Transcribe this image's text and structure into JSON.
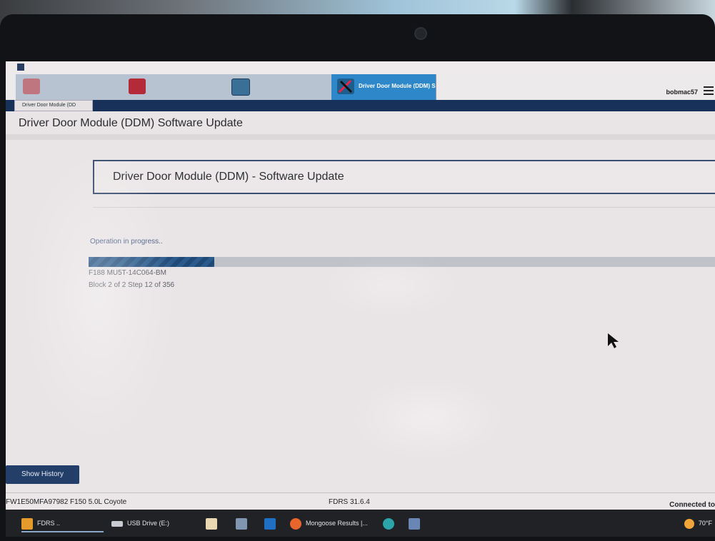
{
  "user": {
    "name": "bobmac57"
  },
  "tabs": [
    {
      "label": "",
      "icon": "vehicle-icon",
      "active": false
    },
    {
      "label": "",
      "icon": "toolbox-icon",
      "active": false
    },
    {
      "label": "",
      "icon": "grid-icon",
      "active": false
    },
    {
      "label": "Driver Door Module (DDM) S",
      "icon": "tools-icon",
      "active": true
    }
  ],
  "subtab": {
    "label": "Driver Door Module (DD"
  },
  "page": {
    "title": "Driver Door Module (DDM) Software Update",
    "panel_title": "Driver Door Module (DDM) - Software Update"
  },
  "progress": {
    "status_text": "Operation in progress..",
    "fraction": 0.2,
    "part_number": "F188 MU5T-14C064-BM",
    "step_text": "Block 2 of 2 Step 12 of 356"
  },
  "buttons": {
    "show_history": "Show History"
  },
  "status_bar": {
    "vin_vehicle": "FW1E50MFA97982  F150 5.0L Coyote",
    "version": "FDRS 31.6.4",
    "connection": "Connected to"
  },
  "taskbar": {
    "items": [
      {
        "label": "FDRS ..",
        "icon": "fdrs-app-icon"
      },
      {
        "label": "USB Drive (E:)",
        "icon": "usb-drive-icon"
      },
      {
        "label": "",
        "icon": "store-icon"
      },
      {
        "label": "",
        "icon": "app-icon"
      },
      {
        "label": "",
        "icon": "outlook-icon"
      },
      {
        "label": "Mongoose Results |...",
        "icon": "firefox-icon"
      },
      {
        "label": "",
        "icon": "edge-icon"
      },
      {
        "label": "",
        "icon": "network-tool-icon"
      }
    ],
    "weather": "70°F"
  },
  "colors": {
    "active_tab": "#2d87c9",
    "header_bar": "#17315a",
    "progress_fill": "#2a5b8c",
    "button": "#233e68"
  }
}
